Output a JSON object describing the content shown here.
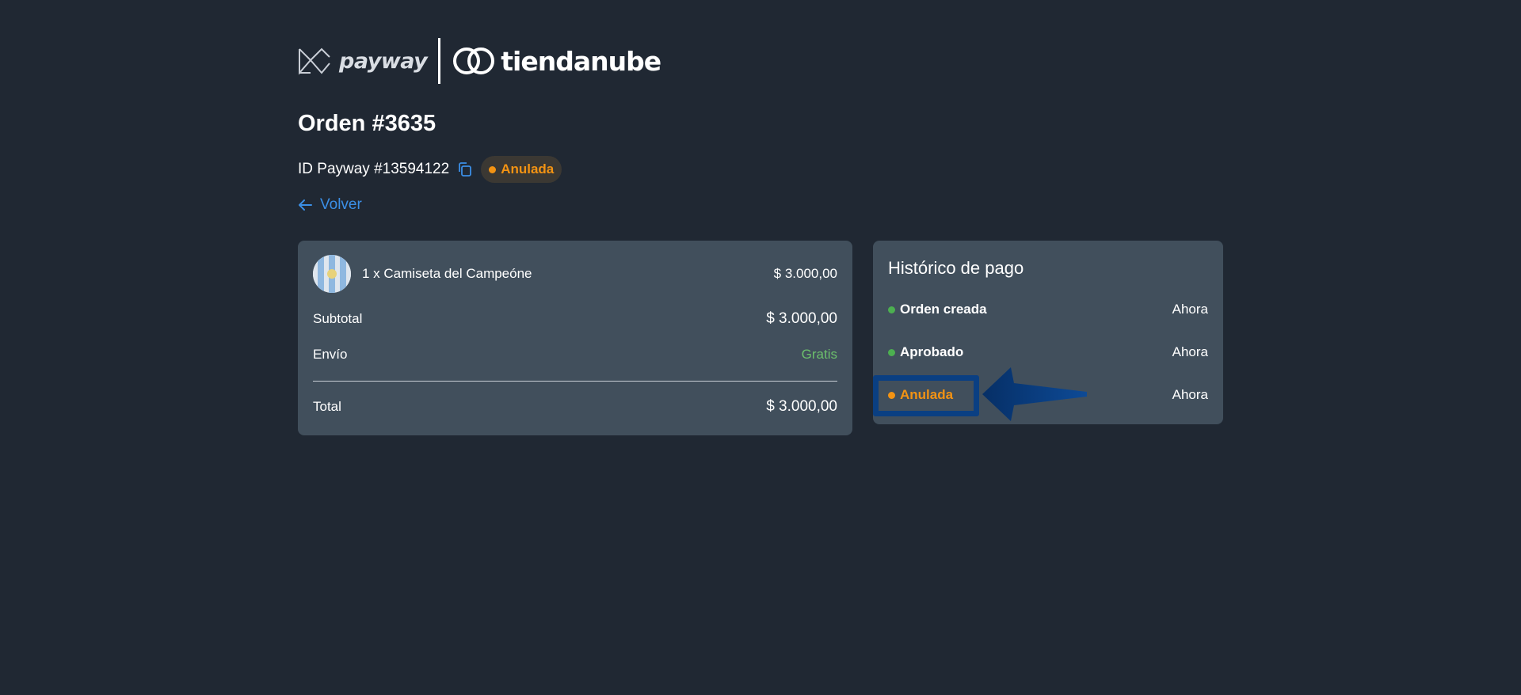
{
  "header": {
    "payway_logo_text": "payway",
    "tiendanube_logo_text": "tiendanube"
  },
  "order": {
    "title": "Orden #3635",
    "payway_id": "ID Payway #13594122",
    "status_label": "Anulada",
    "back_label": "Volver"
  },
  "summary": {
    "product": {
      "name": "1 x Camiseta del Campeóne",
      "price": "$ 3.000,00"
    },
    "subtotal_label": "Subtotal",
    "subtotal_value": "$ 3.000,00",
    "shipping_label": "Envío",
    "shipping_value": "Gratis",
    "total_label": "Total",
    "total_value": "$ 3.000,00"
  },
  "history": {
    "title": "Histórico de pago",
    "events": [
      {
        "label": "Orden creada",
        "time": "Ahora",
        "status_color": "#4caf50"
      },
      {
        "label": "Aprobado",
        "time": "Ahora",
        "status_color": "#4caf50"
      },
      {
        "label": "Anulada",
        "time": "Ahora",
        "status_color": "#f39313"
      }
    ]
  },
  "colors": {
    "background": "#202833",
    "card": "#414f5c",
    "accent_link": "#3b8fe6",
    "status_cancelled": "#f39313",
    "status_ok": "#4caf50",
    "shipping_free": "#6cbf6c",
    "annotation": "#0a3f82"
  },
  "icons": {
    "copy": "copy-icon",
    "back": "arrow-left-icon",
    "payway": "payway-logo-icon",
    "tiendanube": "tiendanube-logo-icon"
  }
}
